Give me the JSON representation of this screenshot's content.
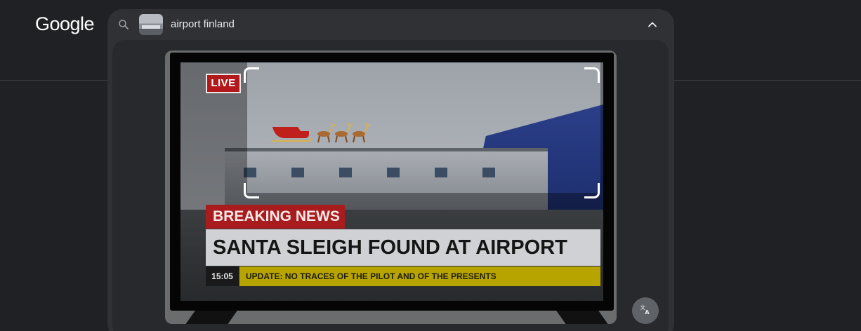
{
  "logo": {
    "text": "Google"
  },
  "search": {
    "query": "airport finland",
    "search_icon": "search-icon",
    "collapse_icon": "chevron-up-icon"
  },
  "lens_image": {
    "live_badge": "LIVE",
    "breaking_banner": "BREAKING NEWS",
    "headline": "SANTA SLEIGH FOUND AT AIRPORT",
    "ticker_time": "15:05",
    "ticker_text": "UPDATE: NO TRACES OF THE PILOT AND OF THE PRESENTS"
  },
  "actions": {
    "translate_icon": "translate-icon"
  },
  "colors": {
    "page_background": "#202124",
    "panel_background": "#303134",
    "breaking_red": "#a81c1d",
    "ticker_yellow": "#b8a400"
  }
}
